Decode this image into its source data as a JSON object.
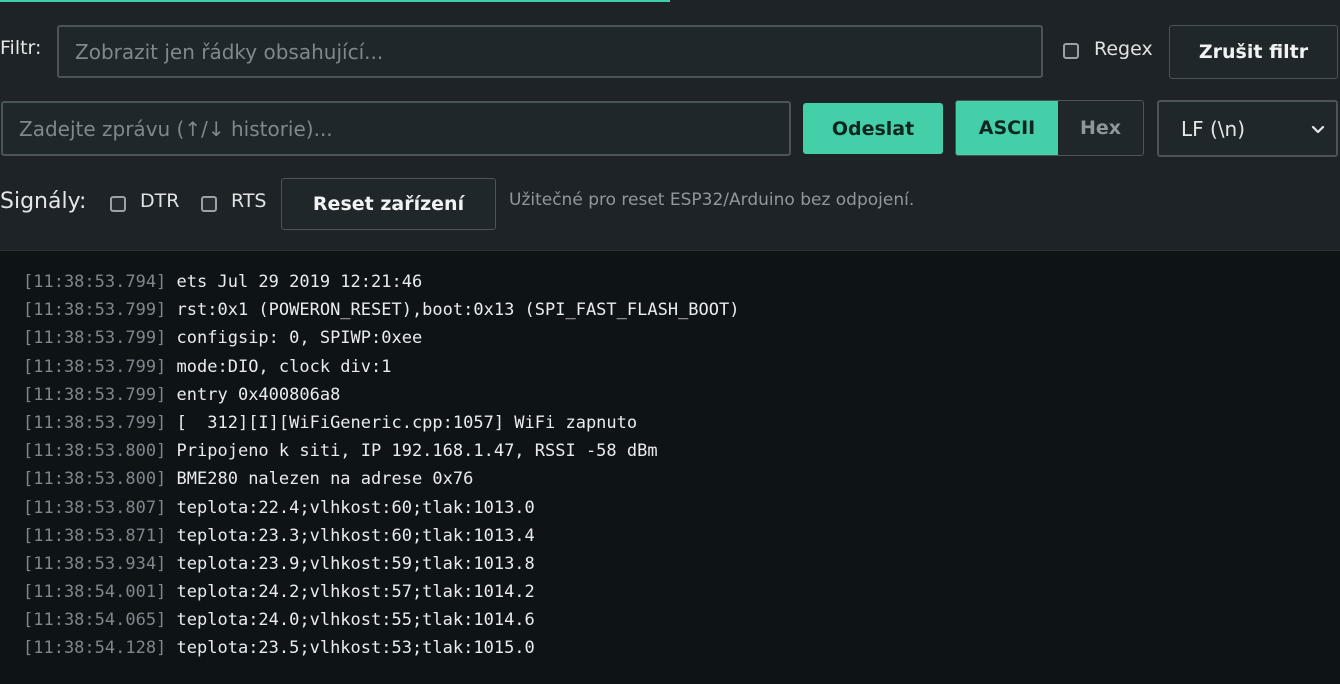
{
  "progress": {
    "fraction": 0.5
  },
  "filter": {
    "label": "Filtr:",
    "placeholder": "Zobrazit jen řádky obsahující...",
    "regex_label": "Regex",
    "regex_checked": false,
    "clear_label": "Zrušit filtr"
  },
  "message": {
    "placeholder": "Zadejte zprávu (↑/↓ historie)...",
    "send_label": "Odeslat",
    "mode_ascii": "ASCII",
    "mode_hex": "Hex",
    "mode_selected": "ASCII",
    "line_ending": "LF (\\n)"
  },
  "signals": {
    "label": "Signály:",
    "dtr_label": "DTR",
    "dtr_checked": false,
    "rts_label": "RTS",
    "rts_checked": false,
    "reset_label": "Reset zařízení",
    "hint": "Užitečné pro reset ESP32/Arduino bez odpojení."
  },
  "log": [
    {
      "ts": "[11:38:53.794]",
      "text": "ets Jul 29 2019 12:21:46"
    },
    {
      "ts": "[11:38:53.799]",
      "text": "rst:0x1 (POWERON_RESET),boot:0x13 (SPI_FAST_FLASH_BOOT)"
    },
    {
      "ts": "[11:38:53.799]",
      "text": "configsip: 0, SPIWP:0xee"
    },
    {
      "ts": "[11:38:53.799]",
      "text": "mode:DIO, clock div:1"
    },
    {
      "ts": "[11:38:53.799]",
      "text": "entry 0x400806a8"
    },
    {
      "ts": "[11:38:53.799]",
      "text": "[  312][I][WiFiGeneric.cpp:1057] WiFi zapnuto"
    },
    {
      "ts": "[11:38:53.800]",
      "text": "Pripojeno k siti, IP 192.168.1.47, RSSI -58 dBm"
    },
    {
      "ts": "[11:38:53.800]",
      "text": "BME280 nalezen na adrese 0x76"
    },
    {
      "ts": "[11:38:53.807]",
      "text": "teplota:22.4;vlhkost:60;tlak:1013.0"
    },
    {
      "ts": "[11:38:53.871]",
      "text": "teplota:23.3;vlhkost:60;tlak:1013.4"
    },
    {
      "ts": "[11:38:53.934]",
      "text": "teplota:23.9;vlhkost:59;tlak:1013.8"
    },
    {
      "ts": "[11:38:54.001]",
      "text": "teplota:24.2;vlhkost:57;tlak:1014.2"
    },
    {
      "ts": "[11:38:54.065]",
      "text": "teplota:24.0;vlhkost:55;tlak:1014.6"
    },
    {
      "ts": "[11:38:54.128]",
      "text": "teplota:23.5;vlhkost:53;tlak:1015.0"
    }
  ],
  "colors": {
    "accent": "#44cfa8",
    "background": "#1d2326",
    "log_background": "#0e1316"
  }
}
